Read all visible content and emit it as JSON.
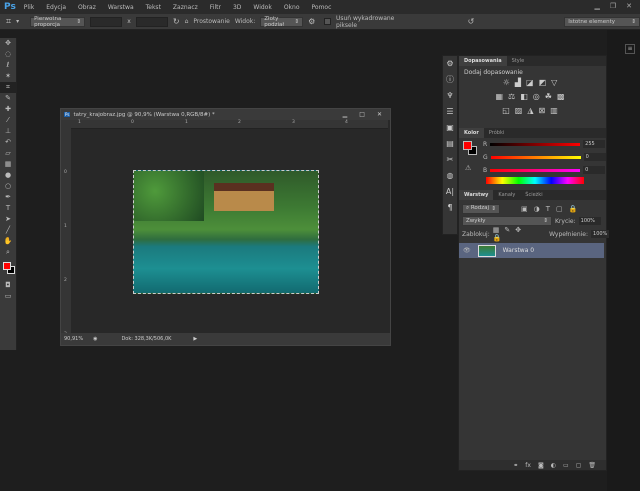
{
  "app": {
    "logo": "Ps"
  },
  "menu": [
    "Plik",
    "Edycja",
    "Obraz",
    "Warstwa",
    "Tekst",
    "Zaznacz",
    "Filtr",
    "3D",
    "Widok",
    "Okno",
    "Pomoc"
  ],
  "options": {
    "ratio": "Pierwotna proporcja",
    "x_sep": "x",
    "straighten": "Prostowanie",
    "view_label": "Widok:",
    "view_value": "Złoty podział",
    "delete_cropped": "Usuń wykadrowane piksele",
    "workspace": "Istotne elementy"
  },
  "document": {
    "title": "tatry_krajobraz.jpg @ 90,9% (Warstwa 0,RGB/8#) *",
    "zoom": "90,91%",
    "doc_size": "Dok: 328,3K/506,0K",
    "ruler_h": [
      "1",
      "0",
      "1",
      "2",
      "3",
      "4"
    ],
    "ruler_v": [
      "0",
      "1",
      "2",
      "3"
    ]
  },
  "adjustments": {
    "tabs": [
      "Dopasowania",
      "Style"
    ],
    "heading": "Dodaj dopasowanie"
  },
  "color": {
    "tabs": [
      "Kolor",
      "Próbki"
    ],
    "r_label": "R",
    "g_label": "G",
    "b_label": "B",
    "r": "255",
    "g": "0",
    "b": "0",
    "foreground": "#ff0000",
    "background": "#000000"
  },
  "layers": {
    "tabs": [
      "Warstwy",
      "Kanały",
      "Ścieżki"
    ],
    "filter": "Rodzaj",
    "blend": "Zwykły",
    "opacity_label": "Krycie:",
    "opacity": "100%",
    "lock_label": "Zablokuj:",
    "fill_label": "Wypełnienie:",
    "fill": "100%",
    "items": [
      {
        "name": "Warstwa 0"
      }
    ]
  }
}
